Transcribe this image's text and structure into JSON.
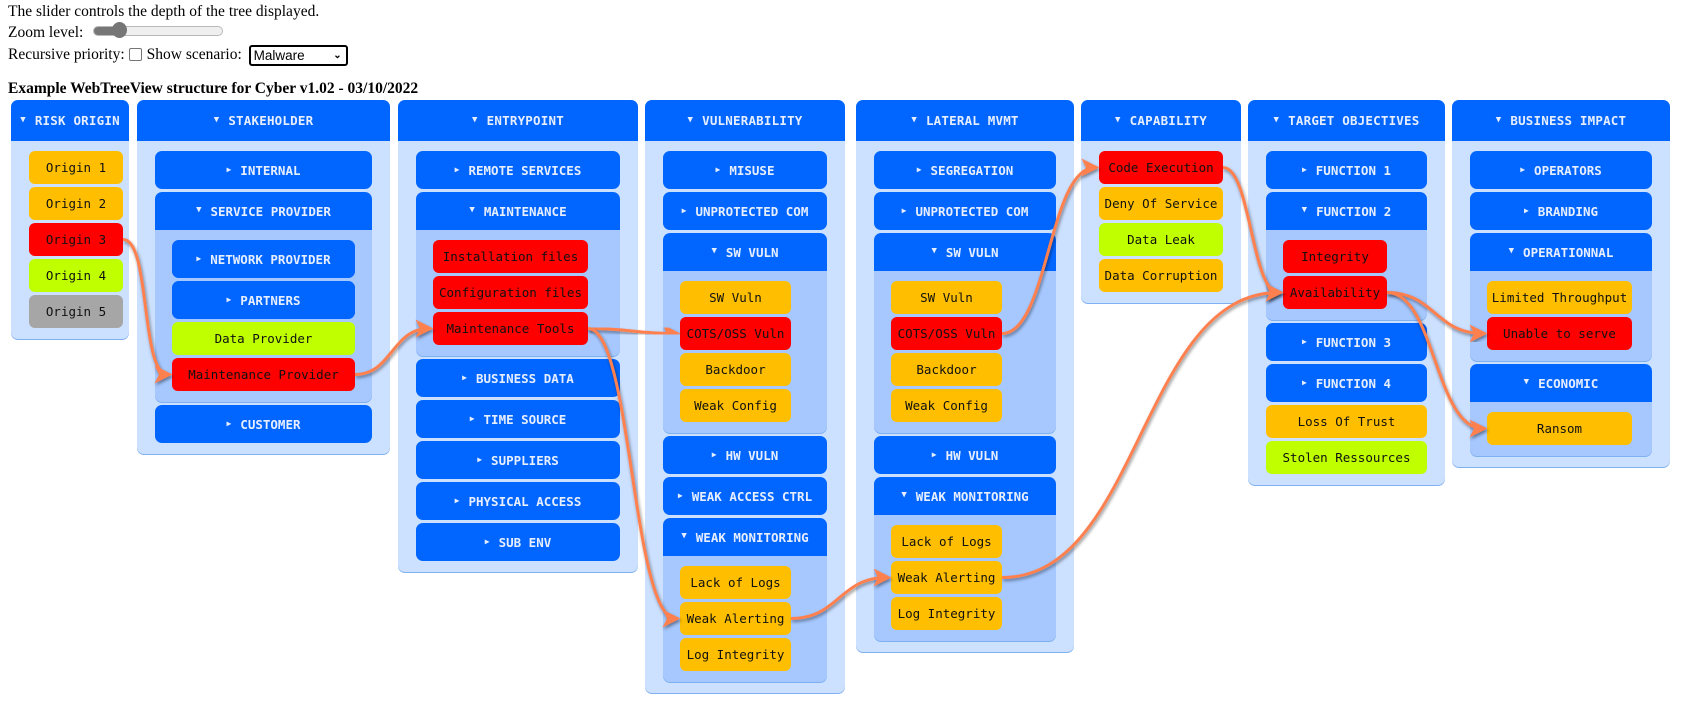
{
  "controls": {
    "description": "The slider controls the depth of the tree displayed.",
    "zoom_label": "Zoom level:",
    "zoom_value_fraction": 0.2,
    "recursive_label": "Recursive priority:",
    "recursive_checked": false,
    "scenario_label": "Show scenario:",
    "scenario_selected": "Malware"
  },
  "title": "Example WebTreeView structure for Cyber v1.02 - 03/10/2022",
  "colors": {
    "header_blue": "#0066ff",
    "panel_light": "#cce0ff",
    "panel_nested": "#a6c8ff",
    "high": "#ff0000",
    "medium": "#ffbf00",
    "low": "#bfff00",
    "none": "#a6a6a6",
    "arrow": "#ff8050"
  },
  "columns": [
    {
      "id": "risk-origin",
      "label": "RISK ORIGIN",
      "expanded": true,
      "items": [
        {
          "type": "leaf",
          "label": "Origin 1",
          "level": "orange"
        },
        {
          "type": "leaf",
          "label": "Origin 2",
          "level": "orange"
        },
        {
          "type": "leaf",
          "label": "Origin 3",
          "level": "red",
          "id": "origin3"
        },
        {
          "type": "leaf",
          "label": "Origin 4",
          "level": "lime"
        },
        {
          "type": "leaf",
          "label": "Origin 5",
          "level": "gray"
        }
      ]
    },
    {
      "id": "stakeholder",
      "label": "STAKEHOLDER",
      "expanded": true,
      "items": [
        {
          "type": "group",
          "label": "INTERNAL",
          "expanded": false
        },
        {
          "type": "group",
          "label": "SERVICE PROVIDER",
          "expanded": true,
          "items": [
            {
              "type": "group",
              "label": "NETWORK PROVIDER",
              "expanded": false
            },
            {
              "type": "group",
              "label": "PARTNERS",
              "expanded": false
            },
            {
              "type": "leaf",
              "label": "Data Provider",
              "level": "lime"
            },
            {
              "type": "leaf",
              "label": "Maintenance Provider",
              "level": "red",
              "id": "maintprov"
            }
          ]
        },
        {
          "type": "group",
          "label": "CUSTOMER",
          "expanded": false
        }
      ]
    },
    {
      "id": "entrypoint",
      "label": "ENTRYPOINT",
      "expanded": true,
      "items": [
        {
          "type": "group",
          "label": "REMOTE SERVICES",
          "expanded": false
        },
        {
          "type": "group",
          "label": "MAINTENANCE",
          "expanded": true,
          "items": [
            {
              "type": "leaf",
              "label": "Installation files",
              "level": "red"
            },
            {
              "type": "leaf",
              "label": "Configuration files",
              "level": "red"
            },
            {
              "type": "leaf",
              "label": "Maintenance Tools",
              "level": "red",
              "id": "mainttools"
            }
          ]
        },
        {
          "type": "group",
          "label": "BUSINESS DATA",
          "expanded": false
        },
        {
          "type": "group",
          "label": "TIME SOURCE",
          "expanded": false
        },
        {
          "type": "group",
          "label": "SUPPLIERS",
          "expanded": false
        },
        {
          "type": "group",
          "label": "PHYSICAL ACCESS",
          "expanded": false
        },
        {
          "type": "group",
          "label": "SUB ENV",
          "expanded": false
        }
      ]
    },
    {
      "id": "vulnerability",
      "label": "VULNERABILITY",
      "expanded": true,
      "items": [
        {
          "type": "group",
          "label": "MISUSE",
          "expanded": false
        },
        {
          "type": "group",
          "label": "UNPROTECTED COM",
          "expanded": false
        },
        {
          "type": "group",
          "label": "SW VULN",
          "expanded": true,
          "items": [
            {
              "type": "leaf",
              "label": "SW Vuln",
              "level": "orange"
            },
            {
              "type": "leaf",
              "label": "COTS/OSS Vuln",
              "level": "red",
              "id": "v_cots"
            },
            {
              "type": "leaf",
              "label": "Backdoor",
              "level": "orange"
            },
            {
              "type": "leaf",
              "label": "Weak Config",
              "level": "orange"
            }
          ]
        },
        {
          "type": "group",
          "label": "HW VULN",
          "expanded": false
        },
        {
          "type": "group",
          "label": "WEAK ACCESS CTRL",
          "expanded": false
        },
        {
          "type": "group",
          "label": "WEAK MONITORING",
          "expanded": true,
          "items": [
            {
              "type": "leaf",
              "label": "Lack of Logs",
              "level": "orange"
            },
            {
              "type": "leaf",
              "label": "Weak Alerting",
              "level": "orange",
              "id": "v_alert"
            },
            {
              "type": "leaf",
              "label": "Log Integrity",
              "level": "orange"
            }
          ]
        }
      ]
    },
    {
      "id": "lateral-mvmt",
      "label": "LATERAL MVMT",
      "expanded": true,
      "items": [
        {
          "type": "group",
          "label": "SEGREGATION",
          "expanded": false
        },
        {
          "type": "group",
          "label": "UNPROTECTED COM",
          "expanded": false
        },
        {
          "type": "group",
          "label": "SW VULN",
          "expanded": true,
          "items": [
            {
              "type": "leaf",
              "label": "SW Vuln",
              "level": "orange"
            },
            {
              "type": "leaf",
              "label": "COTS/OSS Vuln",
              "level": "red",
              "id": "l_cots"
            },
            {
              "type": "leaf",
              "label": "Backdoor",
              "level": "orange"
            },
            {
              "type": "leaf",
              "label": "Weak Config",
              "level": "orange"
            }
          ]
        },
        {
          "type": "group",
          "label": "HW VULN",
          "expanded": false
        },
        {
          "type": "group",
          "label": "WEAK MONITORING",
          "expanded": true,
          "items": [
            {
              "type": "leaf",
              "label": "Lack of Logs",
              "level": "orange"
            },
            {
              "type": "leaf",
              "label": "Weak Alerting",
              "level": "orange",
              "id": "l_alert"
            },
            {
              "type": "leaf",
              "label": "Log Integrity",
              "level": "orange"
            }
          ]
        }
      ]
    },
    {
      "id": "capability",
      "label": "CAPABILITY",
      "expanded": true,
      "items": [
        {
          "type": "leaf",
          "label": "Code Execution",
          "level": "red",
          "id": "codeexec"
        },
        {
          "type": "leaf",
          "label": "Deny Of Service",
          "level": "orange"
        },
        {
          "type": "leaf",
          "label": "Data Leak",
          "level": "lime"
        },
        {
          "type": "leaf",
          "label": "Data Corruption",
          "level": "orange"
        }
      ]
    },
    {
      "id": "target-objectives",
      "label": "TARGET OBJECTIVES",
      "expanded": true,
      "items": [
        {
          "type": "group",
          "label": "FUNCTION 1",
          "expanded": false
        },
        {
          "type": "group",
          "label": "FUNCTION 2",
          "expanded": true,
          "items": [
            {
              "type": "leaf",
              "label": "Integrity",
              "level": "red"
            },
            {
              "type": "leaf",
              "label": "Availability",
              "level": "red",
              "id": "avail"
            }
          ]
        },
        {
          "type": "group",
          "label": "FUNCTION 3",
          "expanded": false
        },
        {
          "type": "group",
          "label": "FUNCTION 4",
          "expanded": false
        },
        {
          "type": "leaf",
          "label": "Loss Of Trust",
          "level": "orange"
        },
        {
          "type": "leaf",
          "label": "Stolen Ressources",
          "level": "lime"
        }
      ]
    },
    {
      "id": "business-impact",
      "label": "BUSINESS IMPACT",
      "expanded": true,
      "items": [
        {
          "type": "group",
          "label": "OPERATORS",
          "expanded": false
        },
        {
          "type": "group",
          "label": "BRANDING",
          "expanded": false
        },
        {
          "type": "group",
          "label": "OPERATIONNAL",
          "expanded": true,
          "items": [
            {
              "type": "leaf",
              "label": "Limited Throughput",
              "level": "orange"
            },
            {
              "type": "leaf",
              "label": "Unable to serve",
              "level": "red",
              "id": "unable"
            }
          ]
        },
        {
          "type": "group",
          "label": "ECONOMIC",
          "expanded": true,
          "items": [
            {
              "type": "leaf",
              "label": "Ransom",
              "level": "orange",
              "id": "ransom"
            }
          ]
        }
      ]
    }
  ],
  "scenario_links": [
    {
      "from": "origin3",
      "to": "maintprov"
    },
    {
      "from": "maintprov",
      "to": "mainttools"
    },
    {
      "from": "mainttools",
      "to": "v_cots"
    },
    {
      "from": "mainttools",
      "to": "v_alert"
    },
    {
      "from": "v_cots",
      "to": "l_cots"
    },
    {
      "from": "v_alert",
      "to": "l_alert"
    },
    {
      "from": "l_cots",
      "to": "codeexec"
    },
    {
      "from": "codeexec",
      "to": "avail"
    },
    {
      "from": "l_alert",
      "to": "avail"
    },
    {
      "from": "avail",
      "to": "unable"
    },
    {
      "from": "avail",
      "to": "ransom"
    }
  ]
}
